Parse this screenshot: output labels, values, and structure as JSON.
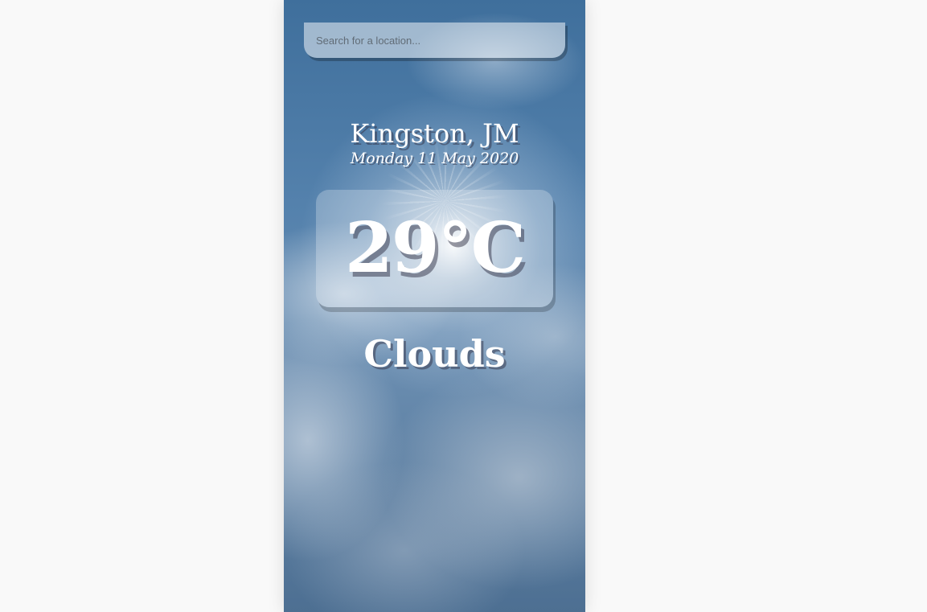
{
  "search": {
    "placeholder": "Search for a location..."
  },
  "location": {
    "name": "Kingston, JM",
    "date": "Monday 11 May 2020"
  },
  "weather": {
    "temperature": "29°C",
    "condition": "Clouds"
  },
  "colors": {
    "page_background": "#f9f9f9",
    "sky_top": "#3f6f9c",
    "sky_bottom": "#4d6f92",
    "text": "#ffffff"
  }
}
